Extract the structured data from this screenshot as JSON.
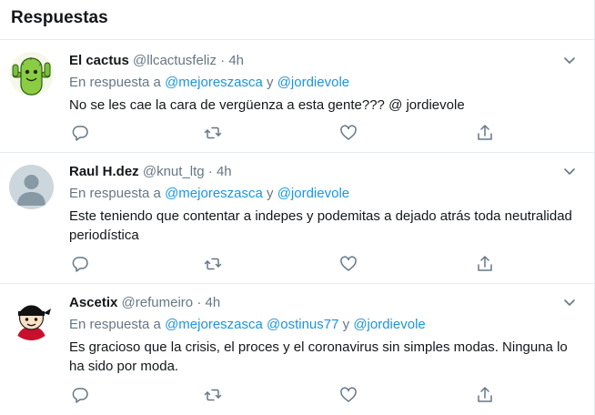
{
  "header": {
    "title": "Respuestas"
  },
  "tweets": [
    {
      "name": "El cactus",
      "handle": "@llcactusfeliz",
      "separator": "·",
      "time": "4h",
      "reply_prefix": "En respuesta a",
      "mentions": [
        "@mejoreszasca",
        "@jordievole"
      ],
      "joiner": "y",
      "text": "No se les cae la cara de vergüenza a esta gente??? @ jordievole"
    },
    {
      "name": "Raul H.dez",
      "handle": "@knut_ltg",
      "separator": "·",
      "time": "4h",
      "reply_prefix": "En respuesta a",
      "mentions": [
        "@mejoreszasca",
        "@jordievole"
      ],
      "joiner": "y",
      "text": "Este teniendo que contentar a indepes y podemitas a dejado atrás toda neutralidad periodística"
    },
    {
      "name": "Ascetix",
      "handle": "@refumeiro",
      "separator": "·",
      "time": "4h",
      "reply_prefix": "En respuesta a",
      "mentions": [
        "@mejoreszasca",
        "@ostinus77",
        "@jordievole"
      ],
      "joiner": "y",
      "text": "Es gracioso que la crisis, el proces y el coronavirus sin simples modas. Ninguna lo ha sido por moda."
    }
  ],
  "icons": {
    "chevron": "chevron-down-icon",
    "reply": "reply-icon",
    "retweet": "retweet-icon",
    "like": "heart-icon",
    "share": "share-icon"
  },
  "colors": {
    "text": "#14171a",
    "secondary": "#657786",
    "link": "#1b95e0",
    "divider": "#e6ecf0"
  }
}
